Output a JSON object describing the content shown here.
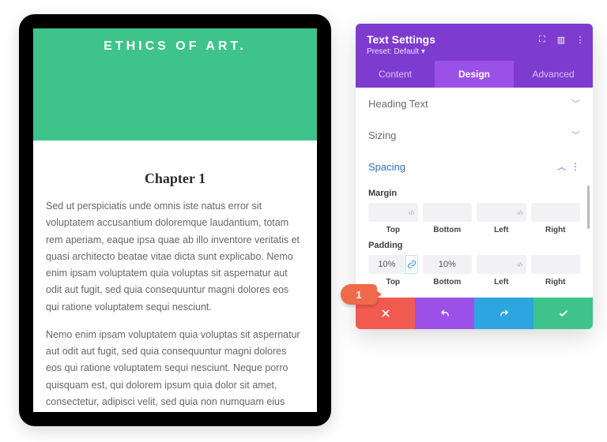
{
  "preview": {
    "heroTitle": "ETHICS OF ART.",
    "chapter": "Chapter 1",
    "para1": "Sed ut perspiciatis unde omnis iste natus error sit voluptatem accusantium doloremque laudantium, totam rem aperiam, eaque ipsa quae ab illo inventore veritatis et quasi architecto beatae vitae dicta sunt explicabo. Nemo enim ipsam voluptatem quia voluptas sit aspernatur aut odit aut fugit, sed quia consequuntur magni dolores eos qui ratione voluptatem sequi nesciunt.",
    "para2": "Nemo enim ipsam voluptatem quia voluptas sit aspernatur aut odit aut fugit, sed quia consequuntur magni dolores eos qui ratione voluptatem sequi nesciunt. Neque porro quisquam est, qui dolorem ipsum quia dolor sit amet, consectetur, adipisci velit, sed quia non numquam eius modi tempora incidunt ut labore et dolore magnam aliquam quaerat voluptatem. Ut enim ad"
  },
  "panel": {
    "title": "Text Settings",
    "preset": "Preset: Default ▾",
    "tabs": {
      "content": "Content",
      "design": "Design",
      "advanced": "Advanced"
    },
    "sections": {
      "heading": "Heading Text",
      "sizing": "Sizing",
      "spacing": "Spacing"
    },
    "margin": {
      "label": "Margin",
      "labels": {
        "top": "Top",
        "bottom": "Bottom",
        "left": "Left",
        "right": "Right"
      },
      "values": {
        "top": "",
        "bottom": "",
        "left": "",
        "right": ""
      }
    },
    "padding": {
      "label": "Padding",
      "labels": {
        "top": "Top",
        "bottom": "Bottom",
        "left": "Left",
        "right": "Right"
      },
      "values": {
        "top": "10%",
        "bottom": "10%",
        "left": "",
        "right": ""
      }
    }
  },
  "marker": "1"
}
